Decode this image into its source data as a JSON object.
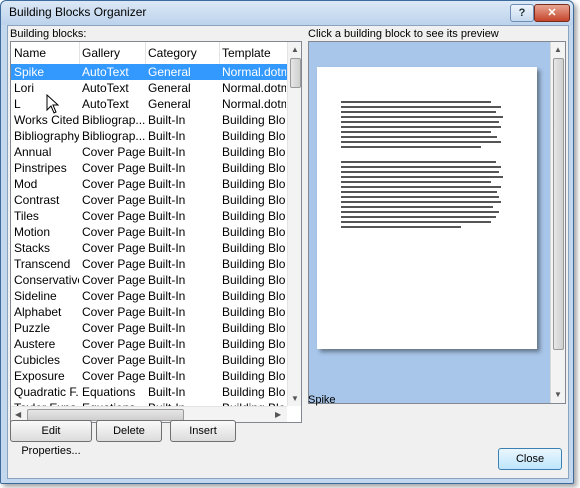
{
  "window": {
    "title": "Building Blocks Organizer",
    "help_glyph": "?",
    "close_glyph": "✕"
  },
  "list": {
    "label": "Building blocks:",
    "columns": [
      "Name",
      "Gallery",
      "Category",
      "Template"
    ],
    "rows": [
      [
        "Spike",
        "AutoText",
        "General",
        "Normal.dotm"
      ],
      [
        "Lori",
        "AutoText",
        "General",
        "Normal.dotm"
      ],
      [
        "L",
        "AutoText",
        "General",
        "Normal.dotm"
      ],
      [
        "Works Cited",
        "Bibliograp...",
        "Built-In",
        "Building Blo..."
      ],
      [
        "Bibliography",
        "Bibliograp...",
        "Built-In",
        "Building Blo..."
      ],
      [
        "Annual",
        "Cover Pages",
        "Built-In",
        "Building Blo..."
      ],
      [
        "Pinstripes",
        "Cover Pages",
        "Built-In",
        "Building Blo..."
      ],
      [
        "Mod",
        "Cover Pages",
        "Built-In",
        "Building Blo..."
      ],
      [
        "Contrast",
        "Cover Pages",
        "Built-In",
        "Building Blo..."
      ],
      [
        "Tiles",
        "Cover Pages",
        "Built-In",
        "Building Blo..."
      ],
      [
        "Motion",
        "Cover Pages",
        "Built-In",
        "Building Blo..."
      ],
      [
        "Stacks",
        "Cover Pages",
        "Built-In",
        "Building Blo..."
      ],
      [
        "Transcend",
        "Cover Pages",
        "Built-In",
        "Building Blo..."
      ],
      [
        "Conservative",
        "Cover Pages",
        "Built-In",
        "Building Blo..."
      ],
      [
        "Sideline",
        "Cover Pages",
        "Built-In",
        "Building Blo..."
      ],
      [
        "Alphabet",
        "Cover Pages",
        "Built-In",
        "Building Blo..."
      ],
      [
        "Puzzle",
        "Cover Pages",
        "Built-In",
        "Building Blo..."
      ],
      [
        "Austere",
        "Cover Pages",
        "Built-In",
        "Building Blo..."
      ],
      [
        "Cubicles",
        "Cover Pages",
        "Built-In",
        "Building Blo..."
      ],
      [
        "Exposure",
        "Cover Pages",
        "Built-In",
        "Building Blo..."
      ],
      [
        "Quadratic F...",
        "Equations",
        "Built-In",
        "Building Blo..."
      ],
      [
        "Taylor Expa...",
        "Equations",
        "Built-In",
        "Building Blo..."
      ]
    ],
    "selected_index": 0
  },
  "buttons": {
    "edit": "Edit Properties...",
    "delete": "Delete",
    "insert": "Insert",
    "close": "Close"
  },
  "preview": {
    "label": "Click a building block to see its preview",
    "caption": "Spike"
  },
  "colors": {
    "selection": "#3399ff",
    "preview_bg": "#a8c6ea",
    "title_close": "#c4442a"
  }
}
